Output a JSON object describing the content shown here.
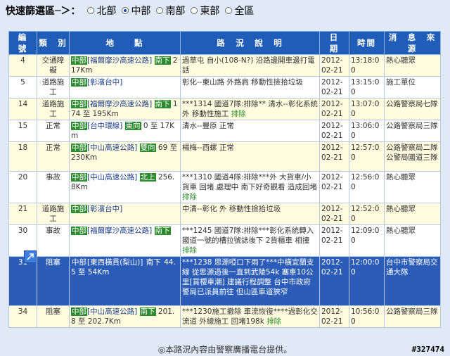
{
  "filter": {
    "title": "快速篩選區─＞：",
    "options": [
      {
        "label": "北部",
        "selected": false
      },
      {
        "label": "中部",
        "selected": true
      },
      {
        "label": "南部",
        "selected": false
      },
      {
        "label": "東部",
        "selected": false
      },
      {
        "label": "全區",
        "selected": false
      }
    ]
  },
  "headers": [
    "編　號",
    "類　別",
    "地　　點",
    "路　況　說　明",
    "日　期",
    "時間",
    "消　息　來　源"
  ],
  "rows": [
    {
      "no": "4",
      "type": "交通障礙",
      "region": "中部",
      "place": "[福爾摩沙高速公路]",
      "dir": "南下",
      "place2": "217Km",
      "desc": "過草屯 自小(108-N?) 沿路邊開車邊打電話",
      "clear": false,
      "date": "2012-02-21",
      "time": "13:18:00",
      "source": "熱心聽眾",
      "style": "odd"
    },
    {
      "no": "5",
      "type": "道路施工",
      "region": "中部",
      "place": "[彰濱台中]",
      "dir": "",
      "place2": "",
      "desc": "彰化--東山路 外路肩 移動性撿拾垃圾",
      "clear": false,
      "date": "2012-02-21",
      "time": "13:15:00",
      "source": "施工單位",
      "style": "even"
    },
    {
      "no": "14",
      "type": "道路施工",
      "region": "中部",
      "place": "[福爾摩沙高速公路]",
      "dir": "南下",
      "place2": "174 至 195Km",
      "desc": "***1314 國道7隊:排除** 清水--彰化系統 外 移動性施工",
      "clear": true,
      "date": "2012-02-21",
      "time": "13:07:00",
      "source": "公路警察局七隊",
      "style": "odd"
    },
    {
      "no": "15",
      "type": "正常",
      "region": "中部",
      "place": "[台中環線]",
      "dir": "東向",
      "place2": "0 至 17Km",
      "desc": "清水--豐原 正常",
      "clear": false,
      "date": "2012-02-21",
      "time": "13:06:00",
      "source": "公路警察局三隊",
      "style": "even"
    },
    {
      "no": "18",
      "type": "正常",
      "region": "中部",
      "place": "[中山高速公路]",
      "dir": "雙向",
      "place2": "69 至 230Km",
      "desc": "楊梅--西螺 正常",
      "clear": false,
      "date": "2012-02-21",
      "time": "12:57:00",
      "source": "公路警察局二隊公警局國道三隊",
      "style": "odd"
    },
    {
      "no": "20",
      "type": "事故",
      "region": "中部",
      "place": "[中山高速公路]",
      "dir": "北上",
      "place2": "256.8Km",
      "desc": "***1310 國道4隊:排除***外 大貨車/小貨車 回堵 處理中 南下好奇觀看 造成回堵",
      "clear": true,
      "date": "2012-02-21",
      "time": "12:56:00",
      "source": "熱心聽眾",
      "style": "even"
    },
    {
      "no": "21",
      "type": "道路施工",
      "region": "中部",
      "place": "[彰濱台中]",
      "dir": "",
      "place2": "",
      "desc": "中清--彰化 外 移動性撿拾垃圾",
      "clear": false,
      "date": "2012-02-21",
      "time": "12:52:00",
      "source": "熱心聽眾",
      "style": "odd"
    },
    {
      "no": "30",
      "type": "事故",
      "region": "中部",
      "place": "[福爾摩沙高速公路]",
      "dir": "南下",
      "place2": "",
      "desc": "***1245 國道7隊:排除***彰化系統轉入國道一號的槽拉號誌後下 2貨櫃車 相撞",
      "clear": true,
      "date": "2012-02-21",
      "time": "12:09:00",
      "source": "熱心聽眾",
      "style": "even"
    },
    {
      "no": "31",
      "type": "阻塞",
      "region": "中部",
      "place": "[東西橫貫(梨山)]",
      "dir": "南下",
      "place2": "44.5 至 54Km",
      "desc": "***1238 思源啞口下雨了***中橫宜蘭支線 從思源過後一直到武陵54k 塞車10公里[賞櫻車潮] 建議行程調整 台中市政府警局已派員前往 但山區車道狹窄",
      "clear": false,
      "date": "2012-02-21",
      "time": "12:00:00",
      "source": "台中市警察局交通大隊",
      "style": "sel"
    },
    {
      "no": "34",
      "type": "阻塞",
      "region": "中部",
      "place": "[中山高速公路]",
      "dir": "南下",
      "place2": "201.8 至 202.7Km",
      "desc": "***1230施工撤除 車流恢復****過彰化交流道 外線施工 回堵198k",
      "clear": true,
      "date": "2012-02-21",
      "time": "10:56:00",
      "source": "公路警察局三隊",
      "style": "odd"
    }
  ],
  "clear_label": "排除",
  "footer": "◎本路況內容由警察廣播電台提供。",
  "watermark": "#327474",
  "colors": {
    "header_bg": "#1f5db8",
    "selected_bg": "#2a5cb8",
    "odd_bg": "#fffde0",
    "tag_green": "#2e8a2e"
  }
}
